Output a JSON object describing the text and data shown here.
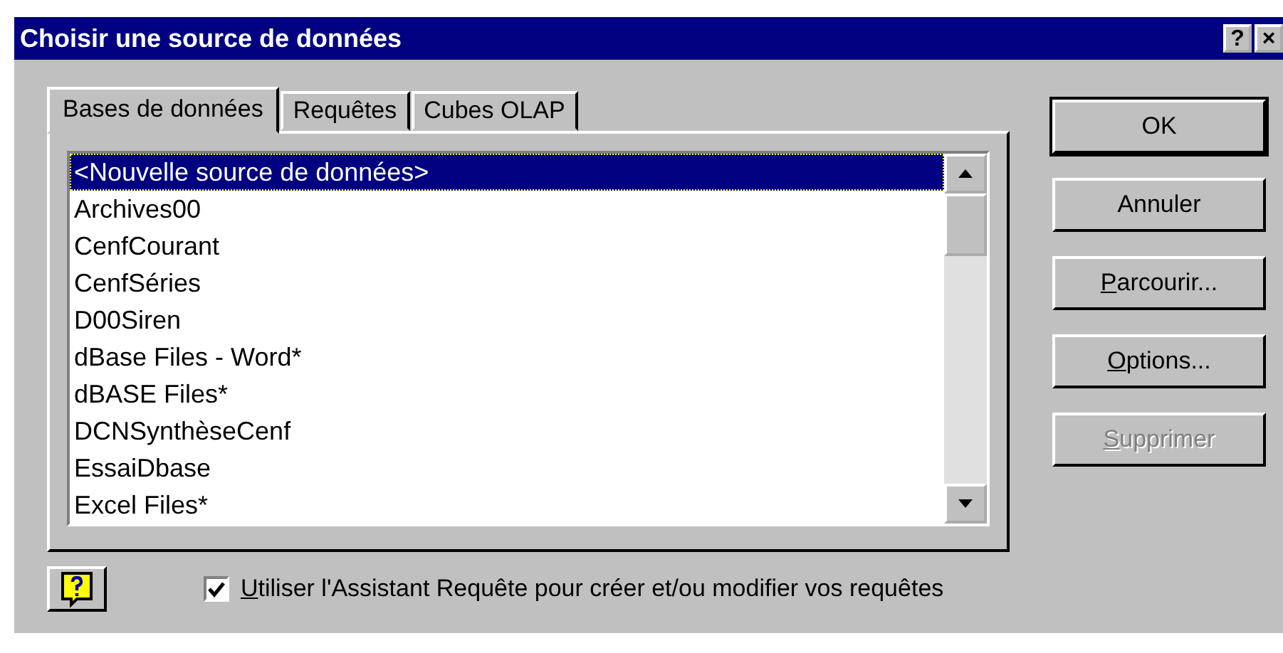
{
  "window": {
    "title": "Choisir une source de données",
    "title_buttons": [
      "?",
      "×"
    ]
  },
  "tabs": [
    {
      "label": "Bases de données",
      "selected": true
    },
    {
      "label": "Requêtes",
      "selected": false
    },
    {
      "label": "Cubes OLAP",
      "selected": false
    }
  ],
  "list": {
    "items": [
      {
        "label": "<Nouvelle source de données>",
        "selected": true
      },
      {
        "label": "Archives00",
        "selected": false
      },
      {
        "label": "CenfCourant",
        "selected": false
      },
      {
        "label": "CenfSéries",
        "selected": false
      },
      {
        "label": "D00Siren",
        "selected": false
      },
      {
        "label": "dBase Files - Word*",
        "selected": false
      },
      {
        "label": "dBASE Files*",
        "selected": false
      },
      {
        "label": "DCNSynthèseCenf",
        "selected": false
      },
      {
        "label": "EssaiDbase",
        "selected": false
      },
      {
        "label": "Excel Files*",
        "selected": false
      }
    ]
  },
  "buttons": [
    {
      "label": "OK",
      "default": true,
      "disabled": false
    },
    {
      "label": "Annuler",
      "default": false,
      "disabled": false
    },
    {
      "label": "Parcourir...",
      "default": false,
      "disabled": false,
      "first_letter_underlined": true
    },
    {
      "label": "Options...",
      "default": false,
      "disabled": false,
      "first_letter_underlined": true
    },
    {
      "label": "Supprimer",
      "default": false,
      "disabled": true,
      "first_letter_underlined": true
    }
  ],
  "wizard_checkbox": {
    "label": "Utiliser l'Assistant Requête pour créer et/ou modifier vos requêtes",
    "checked": true,
    "first_letter_underlined": true
  }
}
